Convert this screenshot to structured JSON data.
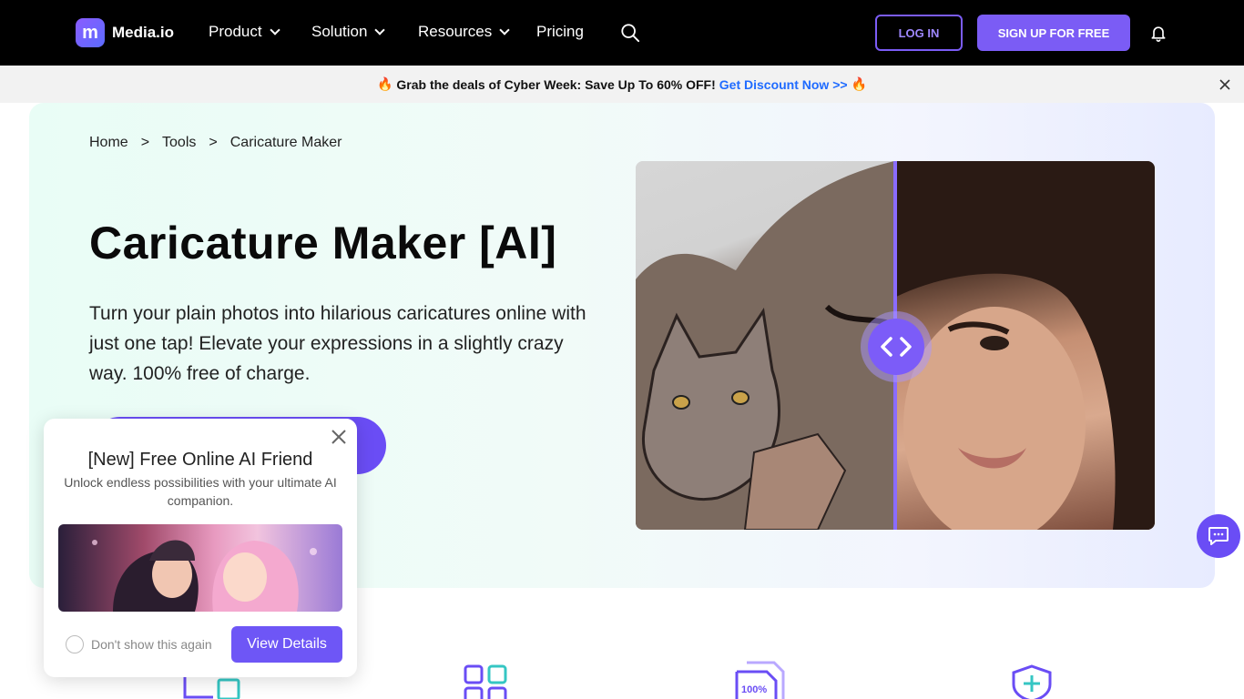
{
  "nav": {
    "brand": "Media.io",
    "items": [
      {
        "label": "Product",
        "has_menu": true
      },
      {
        "label": "Solution",
        "has_menu": true
      },
      {
        "label": "Resources",
        "has_menu": true
      },
      {
        "label": "Pricing",
        "has_menu": false
      }
    ],
    "login_label": "LOG IN",
    "signup_label": "SIGN UP FOR FREE"
  },
  "promo": {
    "text": "Grab the deals of Cyber Week: Save Up To 60% OFF!",
    "link": "Get Discount Now >>"
  },
  "breadcrumb": {
    "items": [
      "Home",
      ">",
      "Tools",
      ">",
      "Caricature Maker"
    ]
  },
  "hero": {
    "title": "Caricature Maker [AI]",
    "description": "Turn your plain photos into hilarious caricatures online with just one tap! Elevate your expressions in a slightly crazy way. 100% free of charge."
  },
  "popup": {
    "title": "[New] Free Online AI Friend",
    "subtitle": "Unlock endless possibilities with your ultimate AI companion.",
    "checkbox_label": "Don't show this again",
    "button_label": "View Details"
  },
  "features": {
    "file_badge": "100%"
  },
  "colors": {
    "accent": "#7b5cf5",
    "nav_bg": "#000000",
    "link": "#1f6bff"
  }
}
